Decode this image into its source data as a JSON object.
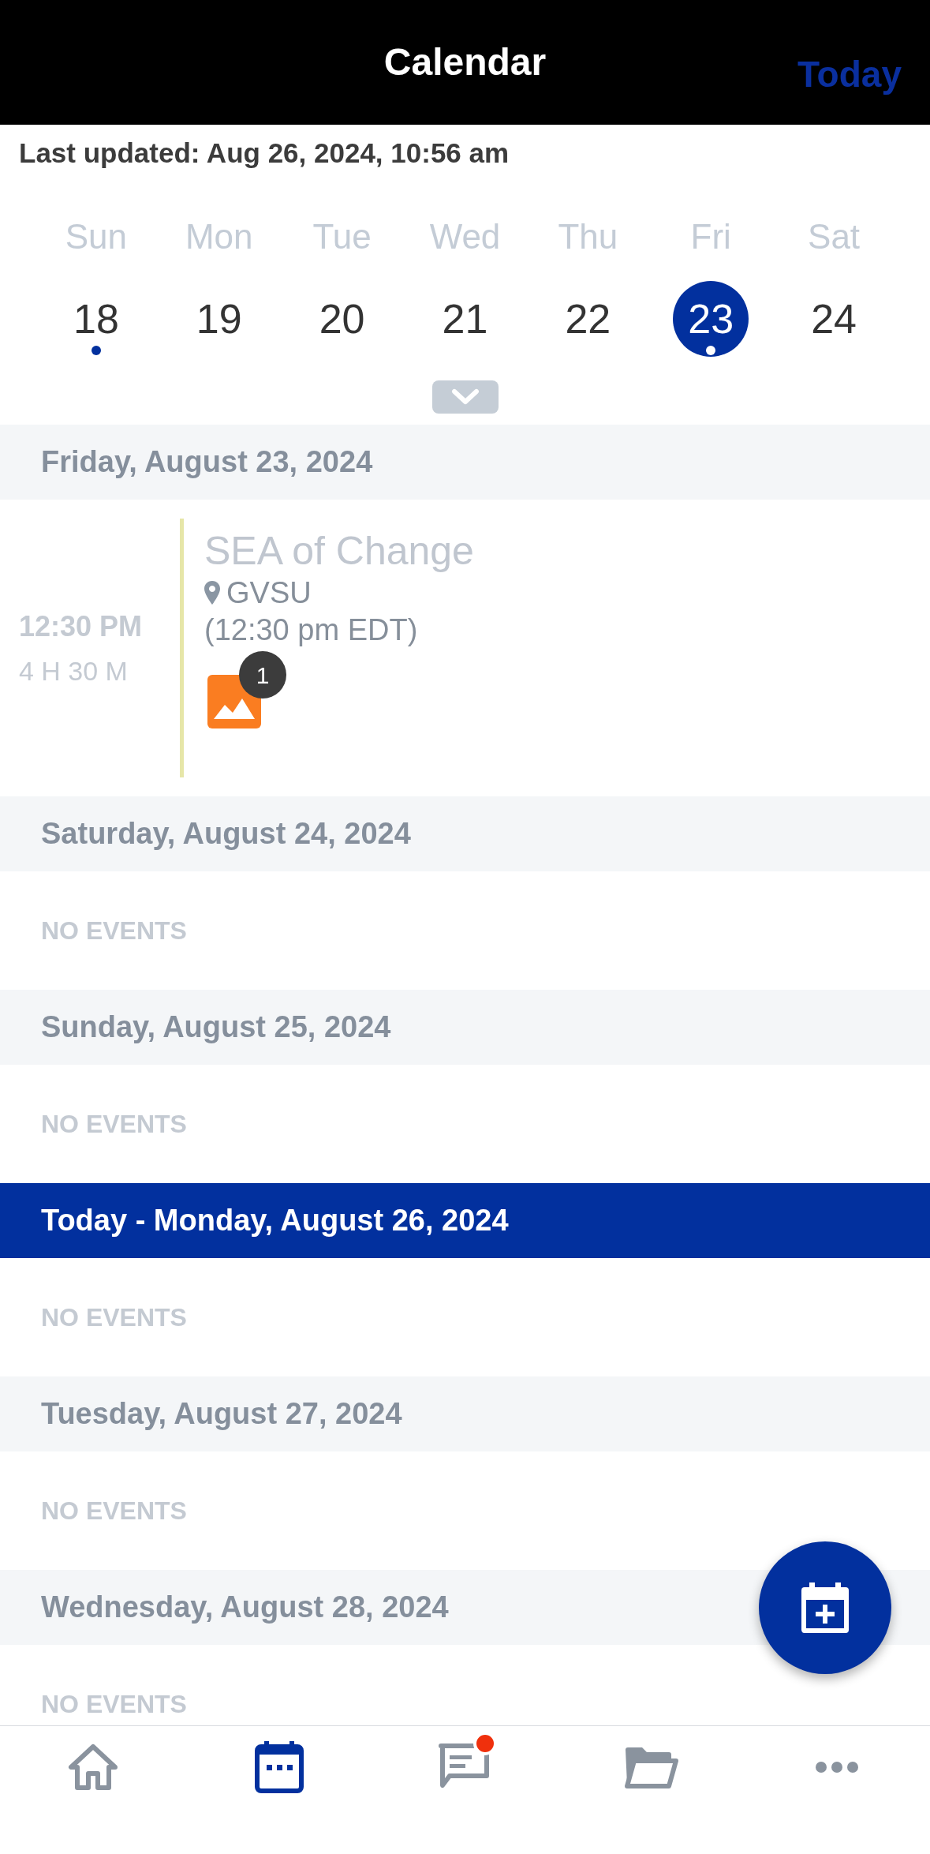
{
  "header": {
    "title": "Calendar",
    "action": "Today"
  },
  "last_updated": "Last updated: Aug 26, 2024, 10:56 am",
  "week": [
    {
      "weekday": "Sun",
      "date": "18",
      "selected": false,
      "has_event": true
    },
    {
      "weekday": "Mon",
      "date": "19",
      "selected": false,
      "has_event": false
    },
    {
      "weekday": "Tue",
      "date": "20",
      "selected": false,
      "has_event": false
    },
    {
      "weekday": "Wed",
      "date": "21",
      "selected": false,
      "has_event": false
    },
    {
      "weekday": "Thu",
      "date": "22",
      "selected": false,
      "has_event": false
    },
    {
      "weekday": "Fri",
      "date": "23",
      "selected": true,
      "has_event": true
    },
    {
      "weekday": "Sat",
      "date": "24",
      "selected": false,
      "has_event": false
    }
  ],
  "sections": [
    {
      "kind": "day",
      "title": "Friday, August 23, 2024",
      "events": [
        {
          "time": "12:30 PM",
          "duration": "4 H 30 M",
          "title": "SEA of Change",
          "location": "GVSU",
          "local_time": "(12:30 pm EDT)",
          "attachments": "1"
        }
      ]
    },
    {
      "kind": "day",
      "title": "Saturday, August 24, 2024",
      "empty_text": "NO EVENTS"
    },
    {
      "kind": "day",
      "title": "Sunday, August 25, 2024",
      "empty_text": "NO EVENTS"
    },
    {
      "kind": "today",
      "title": "Today - Monday, August 26, 2024",
      "empty_text": "NO EVENTS"
    },
    {
      "kind": "day",
      "title": "Tuesday, August 27, 2024",
      "empty_text": "NO EVENTS"
    },
    {
      "kind": "day",
      "title": "Wednesday, August 28, 2024",
      "empty_text": "NO EVENTS"
    }
  ],
  "nav": [
    {
      "kind": "home",
      "selected": false,
      "badge": false
    },
    {
      "kind": "calendar",
      "selected": true,
      "badge": false
    },
    {
      "kind": "messages",
      "selected": false,
      "badge": true
    },
    {
      "kind": "files",
      "selected": false,
      "badge": false
    },
    {
      "kind": "more",
      "selected": false,
      "badge": false
    }
  ]
}
